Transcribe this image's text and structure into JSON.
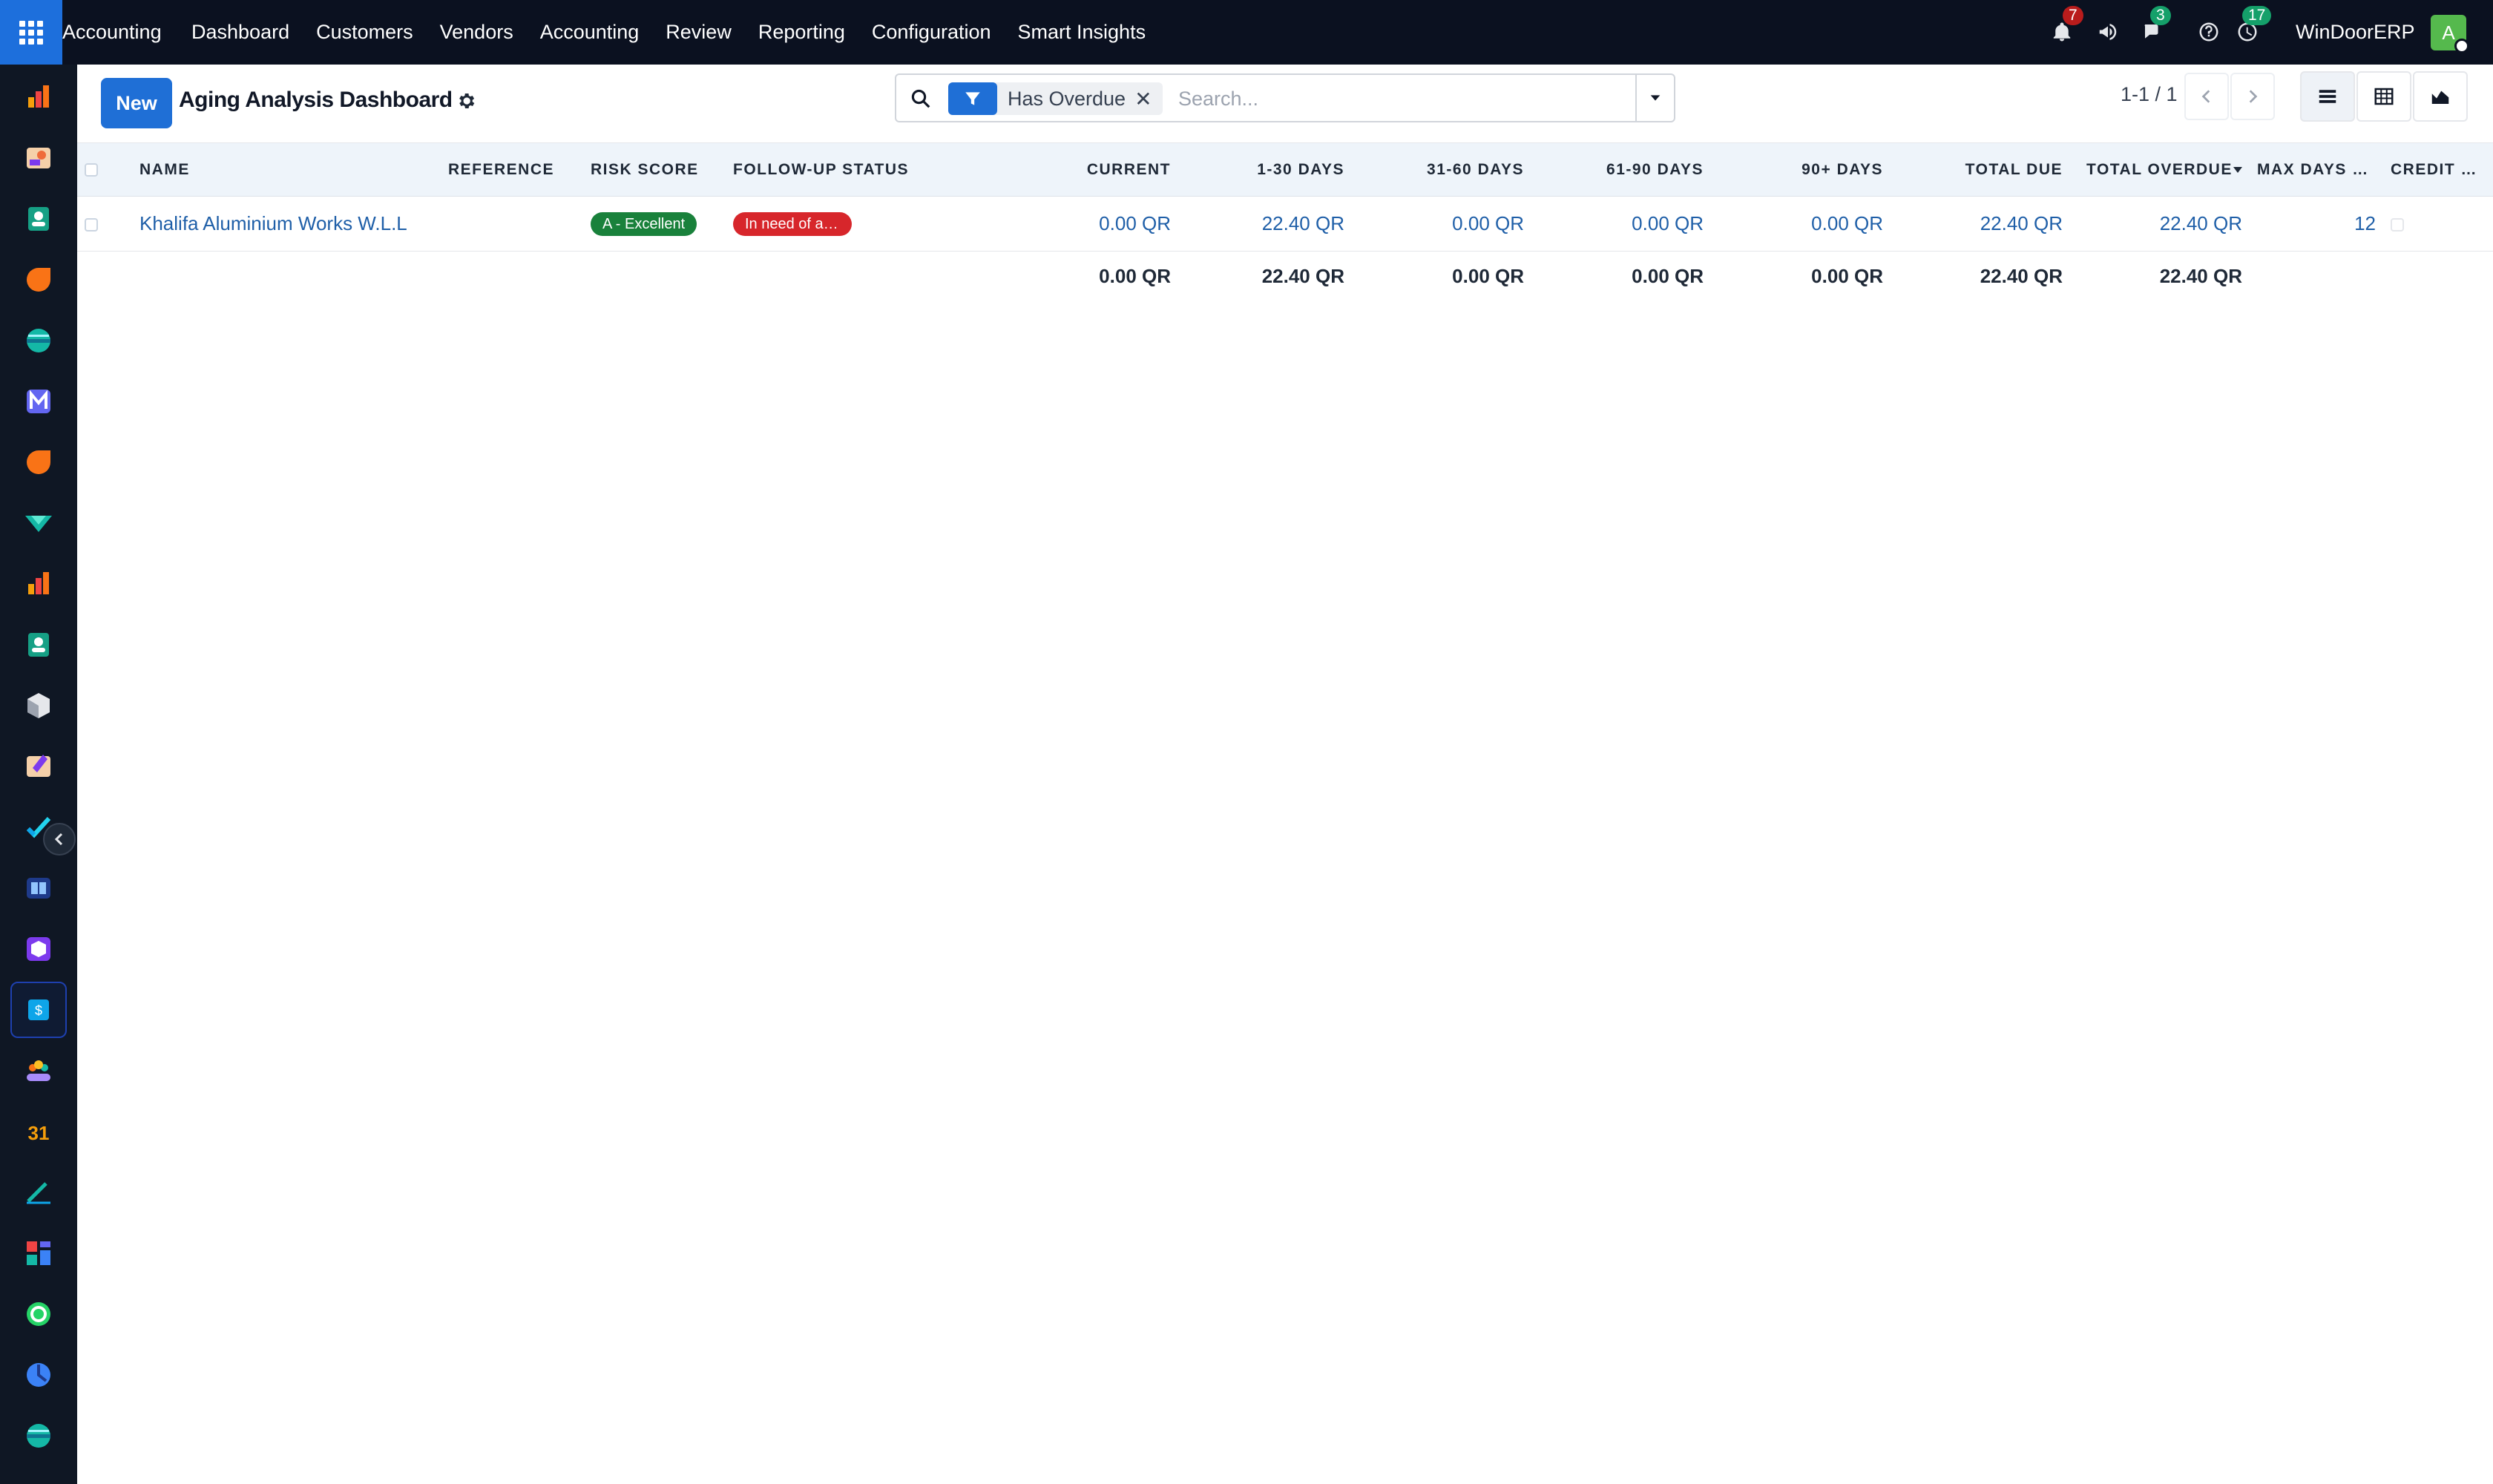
{
  "topbar": {
    "brand": "Accounting",
    "menu": [
      "Dashboard",
      "Customers",
      "Vendors",
      "Accounting",
      "Review",
      "Reporting",
      "Configuration",
      "Smart Insights"
    ],
    "notifications_count": "7",
    "messages_count": "3",
    "activities_count": "17",
    "company": "WinDoorERP",
    "avatar_letter": "A",
    "icons": [
      "apps-grid-icon",
      "bell-icon",
      "megaphone-icon",
      "chat-icon",
      "help-icon",
      "clock-icon"
    ]
  },
  "sidebar": {
    "icons": [
      "accounting-icon",
      "discuss-icon",
      "contacts-icon",
      "crm-icon",
      "website-icon",
      "email-marketing-icon",
      "livechat-icon",
      "helpdesk-icon",
      "reporting-icon",
      "employees-icon",
      "inventory-icon",
      "sales-icon",
      "project-icon",
      "knowledge-icon",
      "apps-icon",
      "invoicing-icon",
      "team-icon",
      "calendar-icon",
      "sign-icon",
      "dashboards-icon",
      "whatsapp-icon",
      "planning-icon",
      "website2-icon"
    ],
    "active_icon": "invoicing-icon",
    "calendar_day": "31"
  },
  "control_panel": {
    "new_label": "New",
    "title": "Aging Analysis Dashboard",
    "facet_label": "Has Overdue",
    "facet_remove": "✕",
    "search_placeholder": "Search...",
    "pager": "1-1 / 1",
    "views": [
      "list-view",
      "pivot-view",
      "graph-view"
    ]
  },
  "table": {
    "columns": [
      "Name",
      "Reference",
      "Risk Score",
      "Follow-up Status",
      "Current",
      "1-30 Days",
      "31-60 Days",
      "61-90 Days",
      "90+ Days",
      "Total Due",
      "Total Overdue",
      "Max Days Overdue",
      "Credit Hold"
    ],
    "rows": [
      {
        "name": "Khalifa Aluminium Works W.L.L",
        "reference": "",
        "risk_score": "A - Excellent",
        "followup_status": "In need of action",
        "current": "0.00 QR",
        "d1_30": "22.40 QR",
        "d31_60": "0.00 QR",
        "d61_90": "0.00 QR",
        "d90_plus": "0.00 QR",
        "total_due": "22.40 QR",
        "total_overdue": "22.40 QR",
        "max_days": "12",
        "credit_hold": false
      }
    ],
    "totals": {
      "current": "0.00 QR",
      "d1_30": "22.40 QR",
      "d31_60": "0.00 QR",
      "d61_90": "0.00 QR",
      "d90_plus": "0.00 QR",
      "total_due": "22.40 QR",
      "total_overdue": "22.40 QR"
    },
    "colors": {
      "risk_badge": "#19813b",
      "followup_badge": "#d7262b",
      "link": "#1f5fa8",
      "header_bg": "#eef4fa"
    }
  }
}
